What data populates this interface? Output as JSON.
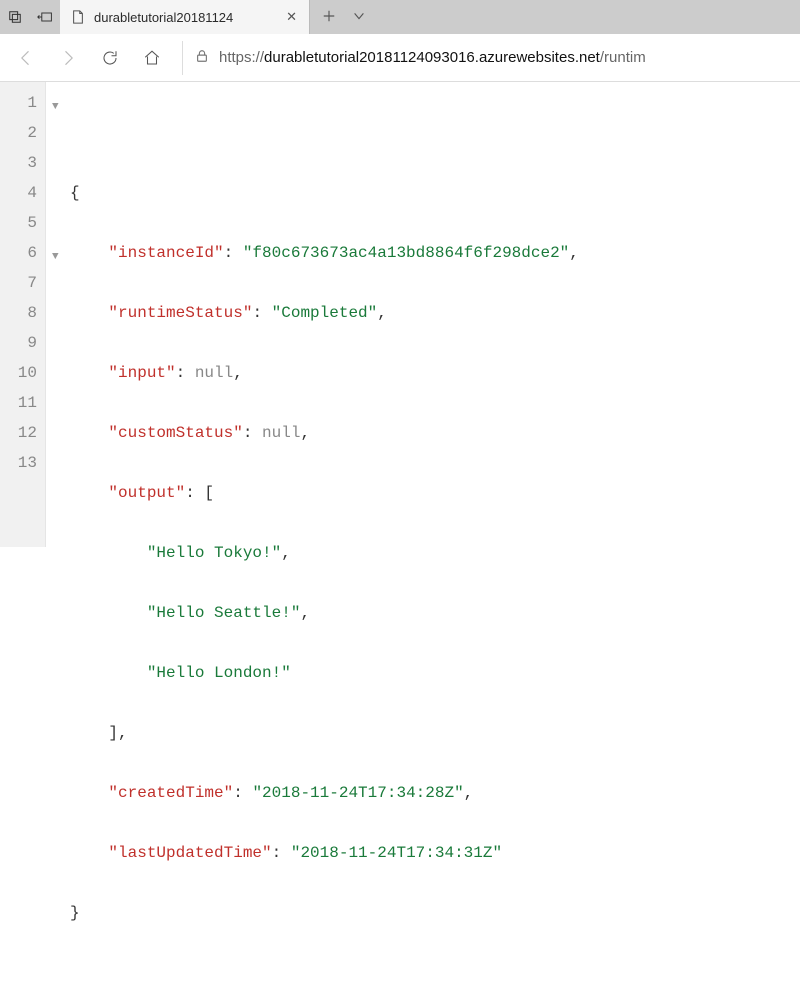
{
  "tab": {
    "title": "durabletutorial20181124"
  },
  "url": {
    "prefix": "https://",
    "host": "durabletutorial20181124093016.azurewebsites.net",
    "suffix": "/runtim"
  },
  "code": {
    "line1": "{",
    "k_instanceId": "\"instanceId\"",
    "v_instanceId": "\"f80c673673ac4a13bd8864f6f298dce2\"",
    "k_runtimeStatus": "\"runtimeStatus\"",
    "v_runtimeStatus": "\"Completed\"",
    "k_input": "\"input\"",
    "v_input": "null",
    "k_customStatus": "\"customStatus\"",
    "v_customStatus": "null",
    "k_output": "\"output\"",
    "v_output0": "\"Hello Tokyo!\"",
    "v_output1": "\"Hello Seattle!\"",
    "v_output2": "\"Hello London!\"",
    "k_createdTime": "\"createdTime\"",
    "v_createdTime": "\"2018-11-24T17:34:28Z\"",
    "k_lastUpdatedTime": "\"lastUpdatedTime\"",
    "v_lastUpdatedTime": "\"2018-11-24T17:34:31Z\"",
    "line13": "}"
  },
  "linenums": {
    "l1": "1",
    "l2": "2",
    "l3": "3",
    "l4": "4",
    "l5": "5",
    "l6": "6",
    "l7": "7",
    "l8": "8",
    "l9": "9",
    "l10": "10",
    "l11": "11",
    "l12": "12",
    "l13": "13"
  }
}
